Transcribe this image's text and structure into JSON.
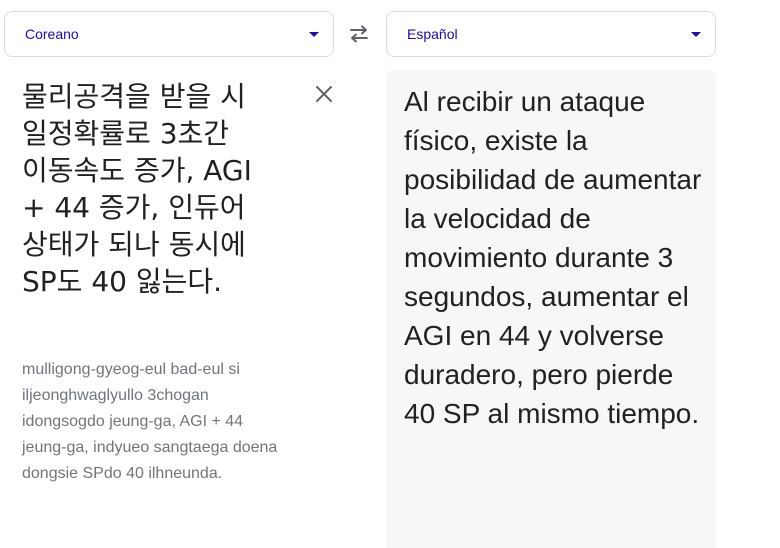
{
  "source_language": {
    "label": "Coreano"
  },
  "target_language": {
    "label": "Español"
  },
  "source": {
    "text": "물리공격을 받을 시 일정확률로 3초간 이동속도 증가, AGI + 44 증가, 인듀어 상태가 되나 동시에 SP도 40 잃는다.",
    "romanization": "mulligong-gyeog-eul bad-eul si iljeonghwaglyullo 3chogan idongsogdo jeung-ga, AGI + 44 jeung-ga, indyueo sangtaega doena dongsie SPdo 40 ilhneunda."
  },
  "target": {
    "text": "Al recibir un ataque físico, existe la posibilidad de aumentar la velocidad de movimiento durante 3 segundos, aumentar el AGI en 44 y volverse duradero, pero pierde 40 SP al mismo tiempo."
  },
  "icons": {
    "swap": "swap-arrows-icon",
    "clear": "close-icon",
    "dropdown": "caret-down-icon"
  },
  "colors": {
    "link": "#1a0dab",
    "icon": "#5f6368",
    "muted": "#70757a",
    "panel": "#f5f7f8"
  }
}
